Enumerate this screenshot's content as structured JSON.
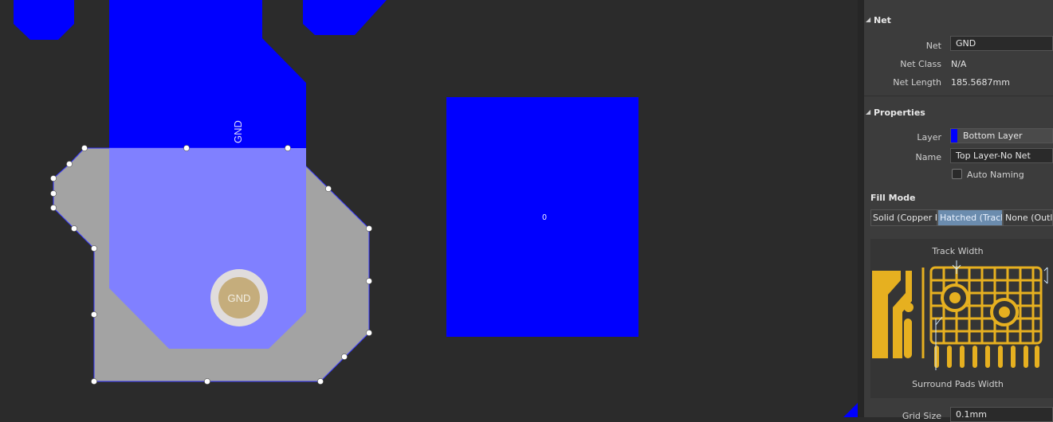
{
  "canvas": {
    "colors": {
      "background": "#2b2b2b",
      "copper": "#0000ff",
      "region_fill": "#a3a3a3",
      "region_overlay": "#8080ff",
      "pad_ring": "#e0dcdc",
      "pad_center": "#c5ad7c",
      "handle": "#ffffff"
    },
    "net_label_vertical": "GND",
    "pad_label": "GND",
    "via_marker": "0"
  },
  "panel": {
    "net_section": {
      "title": "Net",
      "net_label": "Net",
      "net_value": "GND",
      "net_class_label": "Net Class",
      "net_class_value": "N/A",
      "net_length_label": "Net Length",
      "net_length_value": "185.5687mm"
    },
    "properties_section": {
      "title": "Properties",
      "layer_label": "Layer",
      "layer_value": "Bottom Layer",
      "layer_color": "#0000ff",
      "name_label": "Name",
      "name_value": "Top Layer-No Net",
      "auto_naming_label": "Auto Naming",
      "auto_naming_checked": false
    },
    "fill_mode": {
      "title": "Fill Mode",
      "options": [
        "Solid (Copper R",
        "Hatched (Tracks",
        "None (Outli"
      ],
      "selected": "Hatched (Tracks",
      "track_width_label": "Track Width",
      "surround_pads_label": "Surround Pads Width",
      "illustration_color": "#e6b020"
    },
    "grid_size_label": "Grid Size",
    "grid_size_value": "0.1mm"
  }
}
